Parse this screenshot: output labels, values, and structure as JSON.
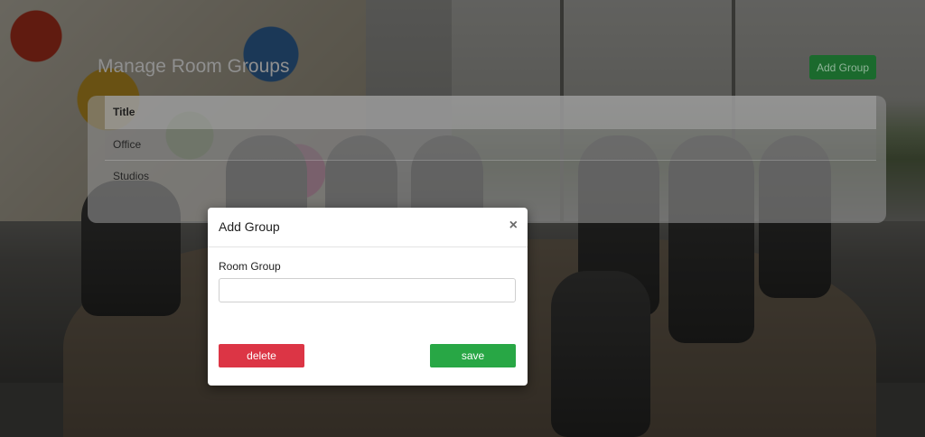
{
  "header": {
    "title": "Manage Room Groups",
    "add_group_label": "Add Group"
  },
  "table": {
    "columns": [
      "Title"
    ],
    "rows": [
      "Office",
      "Studios"
    ]
  },
  "modal": {
    "title": "Add Group",
    "close_glyph": "×",
    "field_label": "Room Group",
    "field_value": "",
    "delete_label": "delete",
    "save_label": "save"
  },
  "colors": {
    "delete": "#dc3545",
    "save": "#28a745",
    "add_group": "#1b6a2d"
  },
  "icons": {
    "close": "close-icon"
  }
}
